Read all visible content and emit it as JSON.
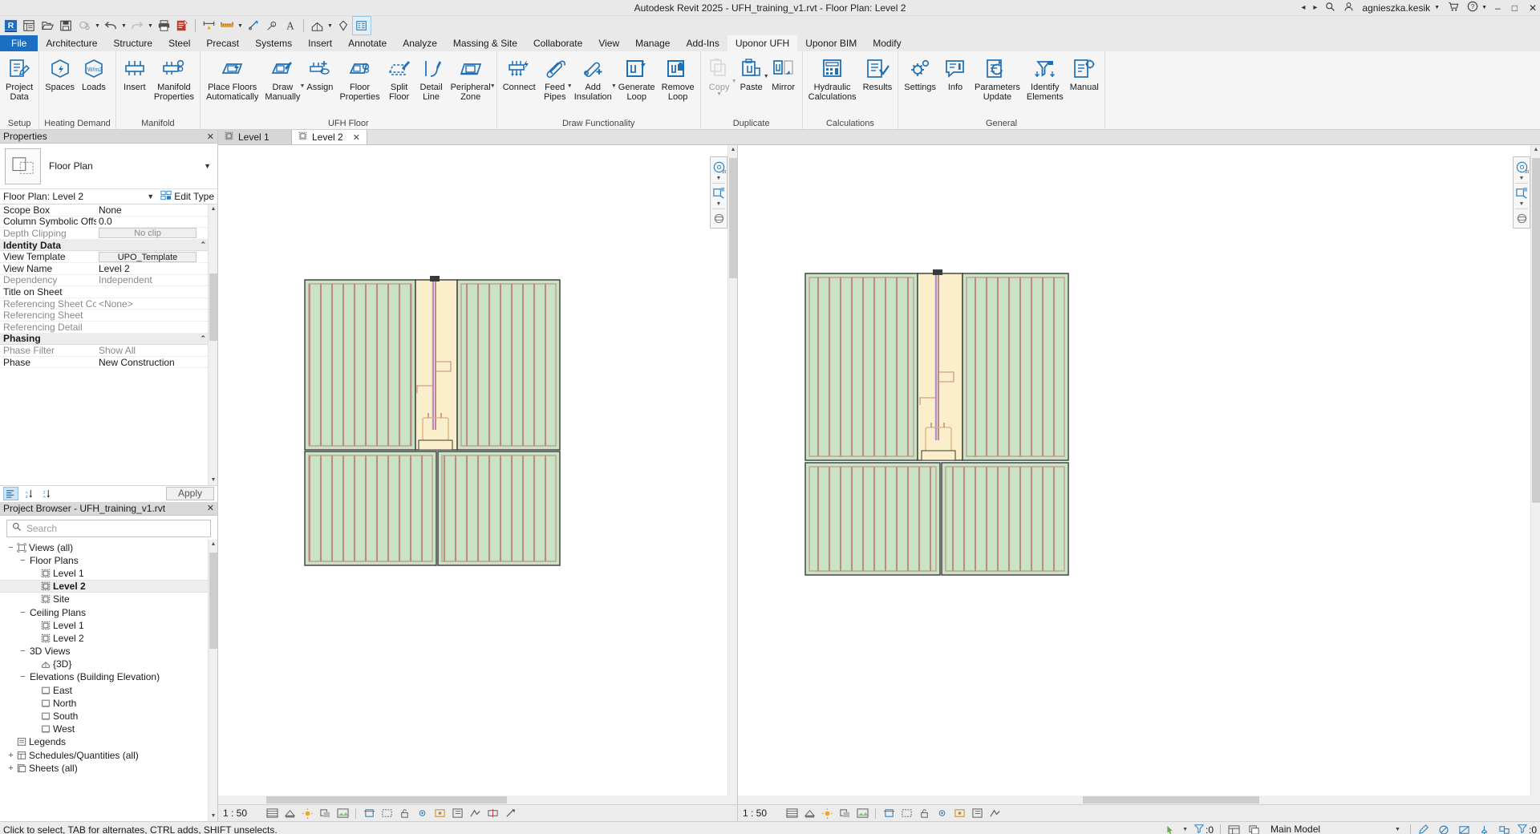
{
  "titlebar": {
    "app_title": "Autodesk Revit 2025 - UFH_training_v1.rvt - Floor Plan: Level 2",
    "account_name": "agnieszka.kesik",
    "nav_prev": "◂",
    "nav_next": "▸",
    "search_icon": "search-icon",
    "cart_icon": "cart-icon",
    "help_label": "?",
    "minimize": "–",
    "maximize": "□",
    "close": "✕"
  },
  "qat": {
    "items": [
      {
        "name": "revit-logo-icon",
        "label": "R"
      },
      {
        "name": "new-project-icon",
        "label": "New"
      },
      {
        "name": "open-icon",
        "label": "Open"
      },
      {
        "name": "save-icon",
        "label": "Save"
      },
      {
        "name": "sync-with-central-icon",
        "label": "Synchronize"
      },
      {
        "name": "undo-icon",
        "label": "Undo"
      },
      {
        "name": "redo-icon",
        "label": "Redo"
      },
      {
        "name": "print-icon",
        "label": "Print"
      },
      {
        "name": "measure-sheet-icon",
        "label": "Sheet"
      },
      {
        "name": "align-dimension-icon",
        "label": "Aligned Dimension"
      },
      {
        "name": "measure-icon",
        "label": "Measure"
      },
      {
        "name": "tag-icon",
        "label": "Tag by Category"
      },
      {
        "name": "text-icon",
        "label": "Text"
      },
      {
        "name": "default-3d-view-icon",
        "label": "Default 3D View"
      },
      {
        "name": "section-icon",
        "label": "Section"
      },
      {
        "name": "switch-windows-icon",
        "label": "Switch Windows"
      }
    ]
  },
  "ribbon": {
    "tabs": [
      {
        "label": "File",
        "active": false,
        "file": true
      },
      {
        "label": "Architecture",
        "active": false
      },
      {
        "label": "Structure",
        "active": false
      },
      {
        "label": "Steel",
        "active": false
      },
      {
        "label": "Precast",
        "active": false
      },
      {
        "label": "Systems",
        "active": false
      },
      {
        "label": "Insert",
        "active": false
      },
      {
        "label": "Annotate",
        "active": false
      },
      {
        "label": "Analyze",
        "active": false
      },
      {
        "label": "Massing & Site",
        "active": false
      },
      {
        "label": "Collaborate",
        "active": false
      },
      {
        "label": "View",
        "active": false
      },
      {
        "label": "Manage",
        "active": false
      },
      {
        "label": "Add-Ins",
        "active": false
      },
      {
        "label": "Uponor UFH",
        "active": true
      },
      {
        "label": "Uponor BIM",
        "active": false
      },
      {
        "label": "Modify",
        "active": false
      }
    ],
    "panels": [
      {
        "title": "Setup",
        "buttons": [
          {
            "name": "project-data-button",
            "label": "Project\nData",
            "icon": "project-data-icon",
            "disabled": false,
            "caret": false
          }
        ]
      },
      {
        "title": "Heating Demand",
        "buttons": [
          {
            "name": "spaces-button",
            "label": "Spaces",
            "icon": "spaces-icon",
            "disabled": false,
            "caret": false
          },
          {
            "name": "loads-button",
            "label": "Loads",
            "icon": "loads-icon",
            "disabled": false,
            "caret": false
          }
        ]
      },
      {
        "title": "Manifold",
        "buttons": [
          {
            "name": "insert-manifold-button",
            "label": "Insert",
            "icon": "insert-manifold-icon",
            "disabled": false,
            "caret": false
          },
          {
            "name": "manifold-properties-button",
            "label": "Manifold\nProperties",
            "icon": "manifold-properties-icon",
            "disabled": false,
            "caret": false
          }
        ]
      },
      {
        "title": "UFH Floor",
        "buttons": [
          {
            "name": "place-floors-automatically-button",
            "label": "Place Floors\nAutomatically",
            "icon": "place-floors-icon",
            "disabled": false,
            "caret": false
          },
          {
            "name": "draw-manually-button",
            "label": "Draw\nManually",
            "icon": "draw-manually-icon",
            "disabled": false,
            "caret": true
          },
          {
            "name": "assign-button",
            "label": "Assign",
            "icon": "assign-icon",
            "disabled": false,
            "caret": false
          },
          {
            "name": "floor-properties-button",
            "label": "Floor\nProperties",
            "icon": "floor-properties-icon",
            "disabled": false,
            "caret": false
          },
          {
            "name": "split-floor-button",
            "label": "Split\nFloor",
            "icon": "split-floor-icon",
            "disabled": false,
            "caret": false
          },
          {
            "name": "detail-line-button",
            "label": "Detail\nLine",
            "icon": "detail-line-icon",
            "disabled": false,
            "caret": false
          },
          {
            "name": "peripheral-zone-button",
            "label": "Peripheral\nZone",
            "icon": "peripheral-zone-icon",
            "disabled": false,
            "caret": true
          }
        ]
      },
      {
        "title": "Draw Functionality",
        "buttons": [
          {
            "name": "connect-button",
            "label": "Connect",
            "icon": "connect-icon",
            "disabled": false,
            "caret": false
          },
          {
            "name": "feed-pipes-button",
            "label": "Feed\nPipes",
            "icon": "feed-pipes-icon",
            "disabled": false,
            "caret": true
          },
          {
            "name": "add-insulation-button",
            "label": "Add\nInsulation",
            "icon": "add-insulation-icon",
            "disabled": false,
            "caret": true
          },
          {
            "name": "generate-loop-button",
            "label": "Generate\nLoop",
            "icon": "generate-loop-icon",
            "disabled": false,
            "caret": false
          },
          {
            "name": "remove-loop-button",
            "label": "Remove\nLoop",
            "icon": "remove-loop-icon",
            "disabled": false,
            "caret": false
          }
        ]
      },
      {
        "title": "Duplicate",
        "buttons": [
          {
            "name": "copy-button",
            "label": "Copy",
            "icon": "copy-icon",
            "disabled": true,
            "caret": true
          },
          {
            "name": "paste-button",
            "label": "Paste",
            "icon": "paste-icon",
            "disabled": false,
            "caret": true
          },
          {
            "name": "mirror-button",
            "label": "Mirror",
            "icon": "mirror-icon",
            "disabled": false,
            "caret": false
          }
        ]
      },
      {
        "title": "Calculations",
        "buttons": [
          {
            "name": "hydraulic-calculations-button",
            "label": "Hydraulic\nCalculations",
            "icon": "calculator-icon",
            "disabled": false,
            "caret": false
          },
          {
            "name": "results-button",
            "label": "Results",
            "icon": "results-icon",
            "disabled": false,
            "caret": false
          }
        ]
      },
      {
        "title": "General",
        "buttons": [
          {
            "name": "settings-button",
            "label": "Settings",
            "icon": "gear-icon",
            "disabled": false,
            "caret": false
          },
          {
            "name": "info-button",
            "label": "Info",
            "icon": "info-icon",
            "disabled": false,
            "caret": false
          },
          {
            "name": "parameters-update-button",
            "label": "Parameters\nUpdate",
            "icon": "parameters-update-icon",
            "disabled": false,
            "caret": false
          },
          {
            "name": "identify-elements-button",
            "label": "Identify\nElements",
            "icon": "identify-elements-icon",
            "disabled": false,
            "caret": false
          },
          {
            "name": "manual-button",
            "label": "Manual",
            "icon": "manual-icon",
            "disabled": false,
            "caret": false
          }
        ]
      }
    ]
  },
  "properties": {
    "panel_title": "Properties",
    "close_label": "✕",
    "type_name": "Floor Plan",
    "selector_value": "Floor Plan: Level 2",
    "edit_type_label": "Edit Type",
    "rows": [
      {
        "key": "Scope Box",
        "value": "None",
        "grey": false,
        "header": false,
        "button": false
      },
      {
        "key": "Column Symbolic Offset",
        "value": "0.0",
        "grey": false,
        "header": false,
        "button": false
      },
      {
        "key": "Depth Clipping",
        "value": "No clip",
        "grey": true,
        "header": false,
        "button": true
      },
      {
        "key": "Identity Data",
        "value": "",
        "grey": false,
        "header": true,
        "button": false
      },
      {
        "key": "View Template",
        "value": "UPO_Template",
        "grey": false,
        "header": false,
        "button": true
      },
      {
        "key": "View Name",
        "value": "Level 2",
        "grey": false,
        "header": false,
        "button": false
      },
      {
        "key": "Dependency",
        "value": "Independent",
        "grey": true,
        "header": false,
        "button": false
      },
      {
        "key": "Title on Sheet",
        "value": "",
        "grey": false,
        "header": false,
        "button": false
      },
      {
        "key": "Referencing Sheet Collec...",
        "value": "<None>",
        "grey": true,
        "header": false,
        "button": false
      },
      {
        "key": "Referencing Sheet",
        "value": "",
        "grey": true,
        "header": false,
        "button": false
      },
      {
        "key": "Referencing Detail",
        "value": "",
        "grey": true,
        "header": false,
        "button": false
      },
      {
        "key": "Phasing",
        "value": "",
        "grey": false,
        "header": true,
        "button": false
      },
      {
        "key": "Phase Filter",
        "value": "Show All",
        "grey": true,
        "header": false,
        "button": false
      },
      {
        "key": "Phase",
        "value": "New Construction",
        "grey": false,
        "header": false,
        "button": false
      }
    ],
    "apply_label": "Apply",
    "sort_buttons": [
      {
        "name": "group-by-category-button",
        "label": "group"
      },
      {
        "name": "sort-ascending-button",
        "label": "A-Z"
      },
      {
        "name": "sort-descending-button",
        "label": "Z-A"
      }
    ]
  },
  "project_browser": {
    "panel_title": "Project Browser - UFH_training_v1.rvt",
    "close_label": "✕",
    "search_placeholder": "Search",
    "search_value": "",
    "tree": [
      {
        "label": "Views (all)",
        "depth": 0,
        "toggle": "−",
        "icon": "views-icon",
        "selected": false
      },
      {
        "label": "Floor Plans",
        "depth": 1,
        "toggle": "−",
        "icon": "",
        "selected": false
      },
      {
        "label": "Level 1",
        "depth": 2,
        "toggle": "",
        "icon": "plan-view-icon",
        "selected": false
      },
      {
        "label": "Level 2",
        "depth": 2,
        "toggle": "",
        "icon": "plan-view-icon",
        "selected": true
      },
      {
        "label": "Site",
        "depth": 2,
        "toggle": "",
        "icon": "plan-view-icon",
        "selected": false
      },
      {
        "label": "Ceiling Plans",
        "depth": 1,
        "toggle": "−",
        "icon": "",
        "selected": false
      },
      {
        "label": "Level 1",
        "depth": 2,
        "toggle": "",
        "icon": "plan-view-icon",
        "selected": false
      },
      {
        "label": "Level 2",
        "depth": 2,
        "toggle": "",
        "icon": "plan-view-icon",
        "selected": false
      },
      {
        "label": "3D Views",
        "depth": 1,
        "toggle": "−",
        "icon": "",
        "selected": false
      },
      {
        "label": "{3D}",
        "depth": 2,
        "toggle": "",
        "icon": "three-d-view-icon",
        "selected": false
      },
      {
        "label": "Elevations (Building Elevation)",
        "depth": 1,
        "toggle": "−",
        "icon": "",
        "selected": false
      },
      {
        "label": "East",
        "depth": 2,
        "toggle": "",
        "icon": "elevation-view-icon",
        "selected": false
      },
      {
        "label": "North",
        "depth": 2,
        "toggle": "",
        "icon": "elevation-view-icon",
        "selected": false
      },
      {
        "label": "South",
        "depth": 2,
        "toggle": "",
        "icon": "elevation-view-icon",
        "selected": false
      },
      {
        "label": "West",
        "depth": 2,
        "toggle": "",
        "icon": "elevation-view-icon",
        "selected": false
      },
      {
        "label": "Legends",
        "depth": 0,
        "toggle": "",
        "icon": "legends-icon",
        "selected": false
      },
      {
        "label": "Schedules/Quantities (all)",
        "depth": 0,
        "toggle": "+",
        "icon": "schedules-icon",
        "selected": false
      },
      {
        "label": "Sheets (all)",
        "depth": 0,
        "toggle": "+",
        "icon": "sheets-icon",
        "selected": false
      }
    ]
  },
  "view_tabs": [
    {
      "label": "Level 1",
      "active": false,
      "closable": false
    },
    {
      "label": "Level 2",
      "active": true,
      "closable": true
    }
  ],
  "view_controls": {
    "left": {
      "scale": "1 : 50",
      "icons": [
        "detail-level-icon",
        "visual-style-icon",
        "sun-path-icon",
        "shadows-icon",
        "rendering-dialog-icon",
        "crop-view-icon",
        "show-crop-icon",
        "unlock-3d-icon",
        "temporary-hide-isolate-icon",
        "reveal-hidden-elements-icon",
        "temporary-view-properties-icon",
        "hide-analytical-model-icon",
        "reveal-constraints-icon",
        "measurement-icon"
      ]
    },
    "right": {
      "scale": "1 : 50",
      "icons": [
        "detail-level-icon",
        "visual-style-icon",
        "sun-path-icon",
        "shadows-icon",
        "rendering-dialog-icon",
        "crop-view-icon",
        "show-crop-icon",
        "unlock-3d-icon",
        "temporary-hide-isolate-icon",
        "reveal-hidden-elements-icon",
        "temporary-view-properties-icon",
        "hide-analytical-model-icon"
      ]
    }
  },
  "statusbar": {
    "message": "Click to select, TAB for alternates, CTRL adds, SHIFT unselects.",
    "worksets_label": "",
    "model_label": "Main Model",
    "filter_count": ":0",
    "selection_count": ":0",
    "right_icons": [
      "editable-only-icon",
      "design-options-icon",
      "exclude-options-icon",
      "active-only-icon",
      "filter-icon"
    ]
  },
  "drawing": {
    "left_view": {
      "rooms": [
        {
          "name": "upper-left-room",
          "fill": "#c9e3c5"
        },
        {
          "name": "upper-corridor",
          "fill": "#faeecb"
        },
        {
          "name": "upper-right-room",
          "fill": "#c9e3c5"
        },
        {
          "name": "lower-left-room",
          "fill": "#c9e3c5"
        },
        {
          "name": "lower-right-room",
          "fill": "#c9e3c5"
        }
      ],
      "pipe_color": "#b87f7f",
      "feed_color": "#b48fd0"
    },
    "right_view": {
      "rooms": [
        {
          "name": "upper-left-room",
          "fill": "#c9e3c5"
        },
        {
          "name": "upper-corridor",
          "fill": "#faeecb"
        },
        {
          "name": "upper-right-room",
          "fill": "#c9e3c5"
        },
        {
          "name": "lower-left-room",
          "fill": "#c9e3c5"
        },
        {
          "name": "lower-right-room",
          "fill": "#c9e3c5"
        }
      ],
      "pipe_color": "#b87f7f",
      "feed_color": "#b48fd0"
    }
  },
  "colors": {
    "revit_blue": "#1b6ec2",
    "icon_blue": "#1f6fb5",
    "ribbon_bg": "#f5f5f5",
    "chrome_bg": "#e9e9e9",
    "room_green": "#c9e3c5",
    "corridor_yellow": "#faeecb"
  }
}
